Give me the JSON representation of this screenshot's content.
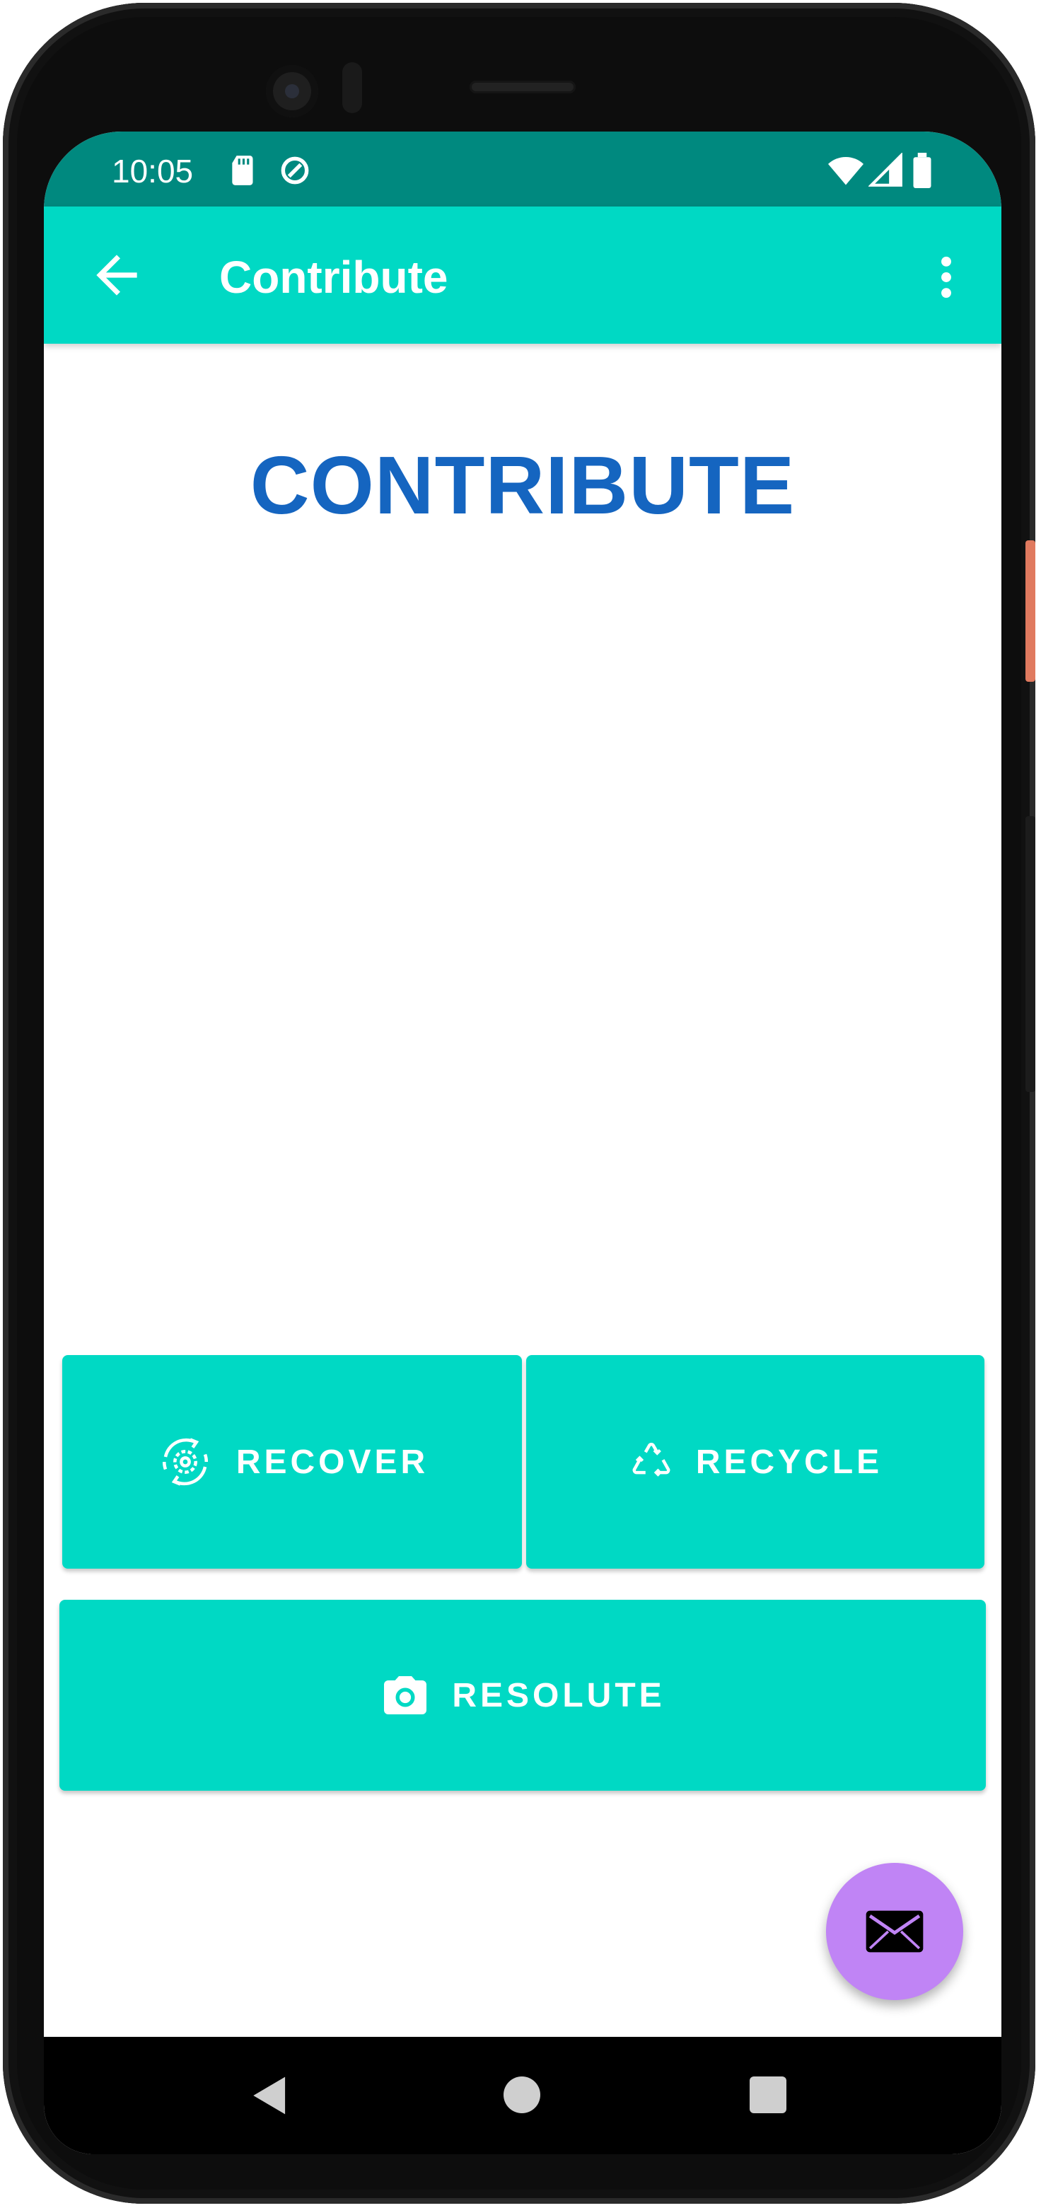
{
  "status_bar": {
    "time": "10:05",
    "left_icons": [
      "sd-card-icon",
      "data-saver-icon"
    ],
    "right_icons": [
      "wifi-icon",
      "cell-signal-icon",
      "battery-icon"
    ]
  },
  "app_bar": {
    "title": "Contribute",
    "back_icon": "arrow-back-icon",
    "menu_icon": "more-vert-icon"
  },
  "main": {
    "heading": "CONTRIBUTE",
    "buttons": {
      "recover": {
        "label": "RECOVER",
        "icon": "recover-gear-cycle-icon"
      },
      "recycle": {
        "label": "RECYCLE",
        "icon": "recycle-icon"
      },
      "resolute": {
        "label": "RESOLUTE",
        "icon": "camera-icon"
      }
    }
  },
  "fab": {
    "icon": "mail-icon"
  },
  "nav_bar": {
    "icons": [
      "nav-back-icon",
      "nav-home-icon",
      "nav-recents-icon"
    ]
  },
  "colors": {
    "status_bar": "#00897f",
    "app_bar": "#00d9c4",
    "heading": "#1565c0",
    "button": "#00d9c4",
    "fab": "#c084f5"
  }
}
